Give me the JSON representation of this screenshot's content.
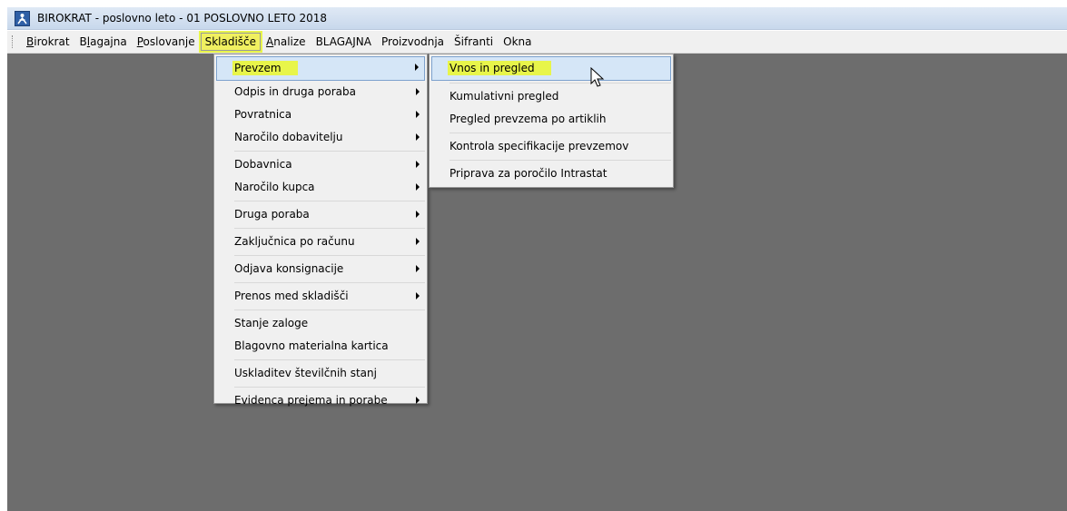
{
  "window": {
    "title": "BIROKRAT - poslovno leto - 01 POSLOVNO LETO 2018",
    "icon": "app-logo-icon"
  },
  "menubar": {
    "items": [
      {
        "label": "Birokrat",
        "underline": "B"
      },
      {
        "label": "Blagajna",
        "underline": "l"
      },
      {
        "label": "Poslovanje",
        "underline": "P"
      },
      {
        "label": "Skladišče",
        "active": true
      },
      {
        "label": "Analize",
        "underline": "A"
      },
      {
        "label": "BLAGAJNA"
      },
      {
        "label": "Proizvodnja"
      },
      {
        "label": "Šifranti"
      },
      {
        "label": "Okna"
      }
    ]
  },
  "skladisce_menu": {
    "items": [
      {
        "label": "Prevzem",
        "submenu": true,
        "highlighted": true
      },
      {
        "label": "Odpis in druga poraba",
        "submenu": true
      },
      {
        "label": "Povratnica",
        "submenu": true
      },
      {
        "label": "Naročilo dobavitelju",
        "submenu": true
      },
      {
        "sep": true
      },
      {
        "label": "Dobavnica",
        "submenu": true
      },
      {
        "label": "Naročilo kupca",
        "submenu": true
      },
      {
        "sep": true
      },
      {
        "label": "Druga poraba",
        "submenu": true
      },
      {
        "sep": true
      },
      {
        "label": "Zaključnica po računu",
        "submenu": true
      },
      {
        "sep": true
      },
      {
        "label": "Odjava konsignacije",
        "submenu": true
      },
      {
        "sep": true
      },
      {
        "label": "Prenos med skladišči",
        "submenu": true
      },
      {
        "sep": true
      },
      {
        "label": "Stanje zaloge"
      },
      {
        "label": "Blagovno materialna kartica"
      },
      {
        "sep": true
      },
      {
        "label": "Uskladitev številčnih stanj"
      },
      {
        "sep": true
      },
      {
        "label": "Evidenca prejema in porabe",
        "submenu": true
      }
    ]
  },
  "prevzem_submenu": {
    "items": [
      {
        "label": "Vnos in pregled",
        "highlighted": true
      },
      {
        "sep": true
      },
      {
        "label": "Kumulativni pregled"
      },
      {
        "label": "Pregled prevzema po artiklih"
      },
      {
        "sep": true
      },
      {
        "label": "Kontrola specifikacije prevzemov"
      },
      {
        "sep": true
      },
      {
        "label": "Priprava za poročilo Intrastat"
      }
    ]
  },
  "colors": {
    "highlight_yellow": "#e8f54a",
    "menu_hover": "#d5e6f7",
    "workspace": "#6d6d6d"
  }
}
